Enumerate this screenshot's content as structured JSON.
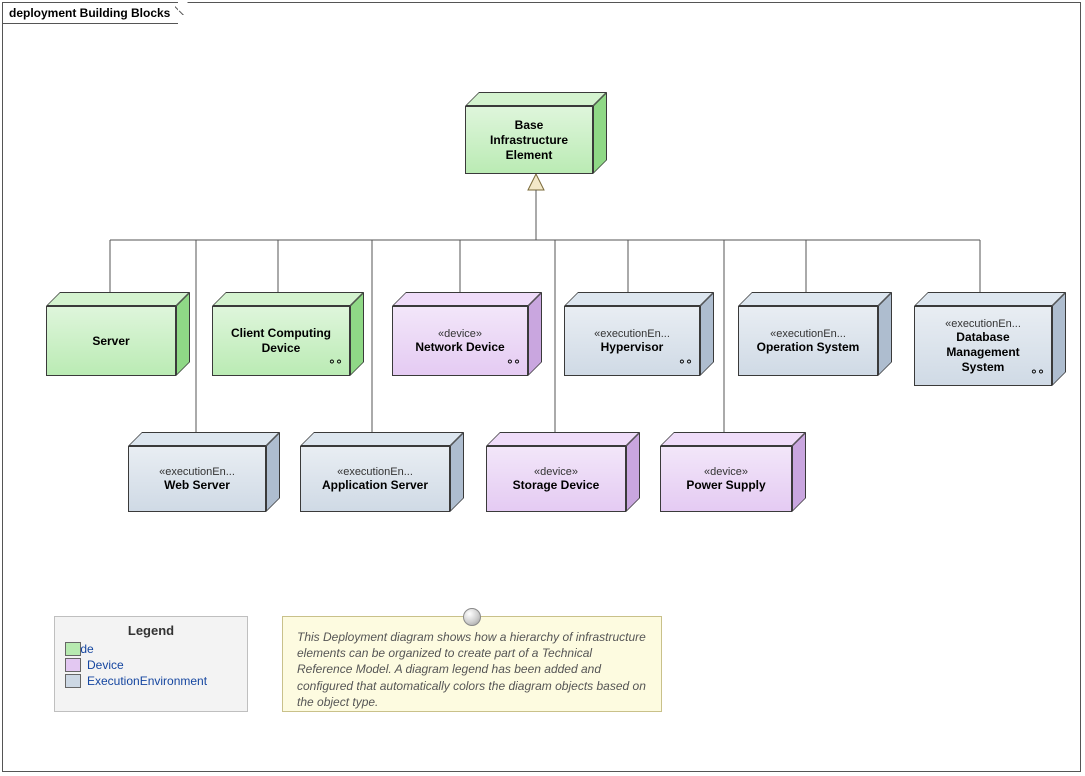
{
  "frame": {
    "title": "deployment Building Blocks"
  },
  "root": {
    "label": "Base\nInfrastructure\nElement"
  },
  "row1": [
    {
      "id": "server",
      "color": "node",
      "stereo": "",
      "label": "Server",
      "glasses": false
    },
    {
      "id": "client",
      "color": "node",
      "stereo": "",
      "label": "Client Computing\nDevice",
      "glasses": true
    },
    {
      "id": "netdev",
      "color": "device",
      "stereo": "«device»",
      "label": "Network Device",
      "glasses": true
    },
    {
      "id": "hyperv",
      "color": "exec",
      "stereo": "«executionEn...",
      "label": "Hypervisor",
      "glasses": true
    },
    {
      "id": "os",
      "color": "exec",
      "stereo": "«executionEn...",
      "label": "Operation System",
      "glasses": false
    },
    {
      "id": "dbms",
      "color": "exec",
      "stereo": "«executionEn...",
      "label": "Database\nManagement\nSystem",
      "glasses": true
    }
  ],
  "row2": [
    {
      "id": "websrv",
      "color": "exec",
      "stereo": "«executionEn...",
      "label": "Web Server",
      "glasses": false
    },
    {
      "id": "appsrv",
      "color": "exec",
      "stereo": "«executionEn...",
      "label": "Application Server",
      "glasses": false
    },
    {
      "id": "storage",
      "color": "device",
      "stereo": "«device»",
      "label": "Storage Device",
      "glasses": false
    },
    {
      "id": "power",
      "color": "device",
      "stereo": "«device»",
      "label": "Power Supply",
      "glasses": false
    }
  ],
  "legend": {
    "title": "Legend",
    "items": [
      {
        "kind": "node",
        "label": "Node"
      },
      {
        "kind": "device",
        "label": "Device"
      },
      {
        "kind": "exec",
        "label": "ExecutionEnvironment"
      }
    ]
  },
  "note": {
    "text": "This Deployment diagram shows how a hierarchy of infrastructure elements can be organized to create part of a Technical Reference Model. A diagram legend has been added and configured that automatically colors the diagram objects based on the object type."
  },
  "chart_data": {
    "type": "tree",
    "title": "deployment Building Blocks",
    "root": {
      "name": "Base Infrastructure Element",
      "type": "Node"
    },
    "children": [
      {
        "name": "Server",
        "type": "Node"
      },
      {
        "name": "Client Computing Device",
        "type": "Node"
      },
      {
        "name": "Network Device",
        "type": "Device"
      },
      {
        "name": "Hypervisor",
        "type": "ExecutionEnvironment"
      },
      {
        "name": "Operation System",
        "type": "ExecutionEnvironment"
      },
      {
        "name": "Database Management System",
        "type": "ExecutionEnvironment"
      },
      {
        "name": "Web Server",
        "type": "ExecutionEnvironment"
      },
      {
        "name": "Application Server",
        "type": "ExecutionEnvironment"
      },
      {
        "name": "Storage Device",
        "type": "Device"
      },
      {
        "name": "Power Supply",
        "type": "Device"
      }
    ],
    "legend": [
      "Node",
      "Device",
      "ExecutionEnvironment"
    ]
  }
}
